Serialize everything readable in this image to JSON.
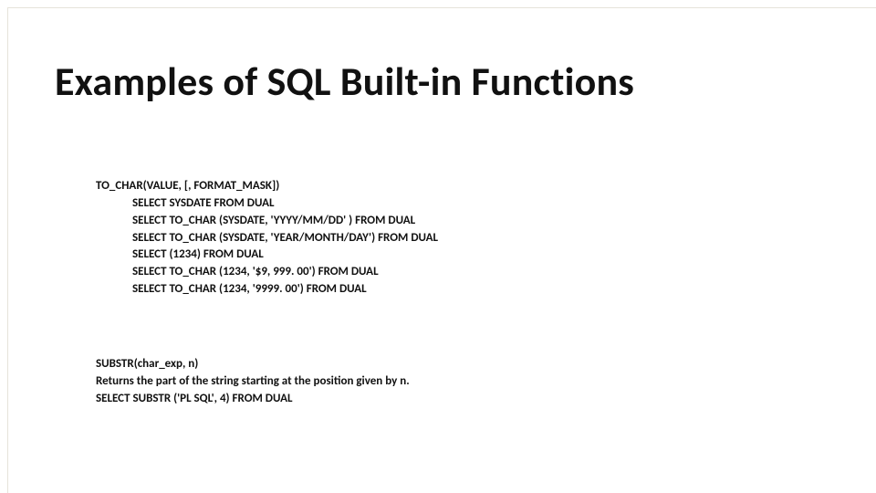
{
  "title": "Examples of SQL Built-in Functions",
  "block1": {
    "heading": "TO_CHAR(VALUE, [, FORMAT_MASK])",
    "lines": [
      "SELECT SYSDATE FROM DUAL",
      "SELECT TO_CHAR (SYSDATE, 'YYYY/MM/DD' ) FROM DUAL",
      "SELECT TO_CHAR (SYSDATE, 'YEAR/MONTH/DAY') FROM DUAL",
      "SELECT (1234) FROM DUAL",
      " SELECT TO_CHAR (1234, '$9, 999. 00') FROM DUAL",
      "SELECT TO_CHAR (1234, '9999. 00') FROM DUAL"
    ]
  },
  "block2": {
    "heading": "SUBSTR(char_exp, n)",
    "lines": [
      "Returns the part of the string starting at the position given by n.",
      "SELECT SUBSTR ('PL SQL', 4) FROM DUAL"
    ]
  }
}
